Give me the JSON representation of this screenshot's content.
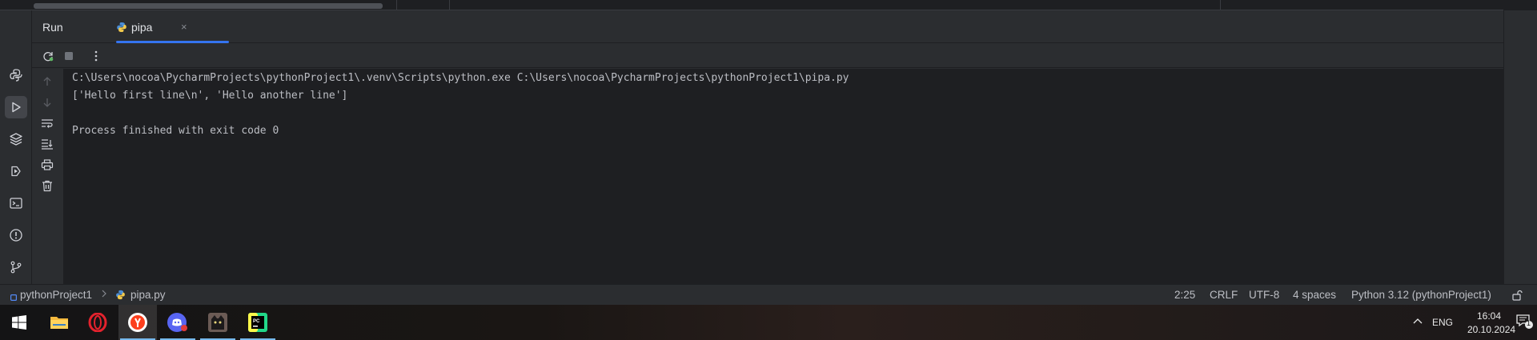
{
  "run_panel": {
    "title": "Run",
    "tab": {
      "label": "pipa",
      "close": "×"
    }
  },
  "console": {
    "lines": [
      "C:\\Users\\nocoa\\PycharmProjects\\pythonProject1\\.venv\\Scripts\\python.exe C:\\Users\\nocoa\\PycharmProjects\\pythonProject1\\pipa.py",
      "['Hello first line\\n', 'Hello another line']",
      "",
      "Process finished with exit code 0"
    ]
  },
  "status_bar": {
    "breadcrumb": [
      "pythonProject1",
      "pipa.py"
    ],
    "position": "2:25",
    "line_ending": "CRLF",
    "encoding": "UTF-8",
    "indent": "4 spaces",
    "interpreter": "Python 3.12 (pythonProject1)"
  },
  "taskbar": {
    "language": "ENG",
    "time": "16:04",
    "date": "20.10.2024",
    "notification_count": "1"
  },
  "colors": {
    "accent": "#3574f0",
    "panel_bg": "#2b2d30",
    "console_bg": "#1e1f22",
    "text": "#bcbec4"
  },
  "icons": {
    "left_stripe": [
      "python-packages-icon",
      "run-icon",
      "layers-icon",
      "services-icon",
      "terminal-icon",
      "problems-icon",
      "git-icon"
    ],
    "run_toolbar": [
      "rerun-icon",
      "stop-icon",
      "more-icon"
    ],
    "console_side": [
      "up-arrow-icon",
      "down-arrow-icon",
      "soft-wrap-icon",
      "scroll-to-end-icon",
      "print-icon",
      "clear-icon"
    ]
  }
}
